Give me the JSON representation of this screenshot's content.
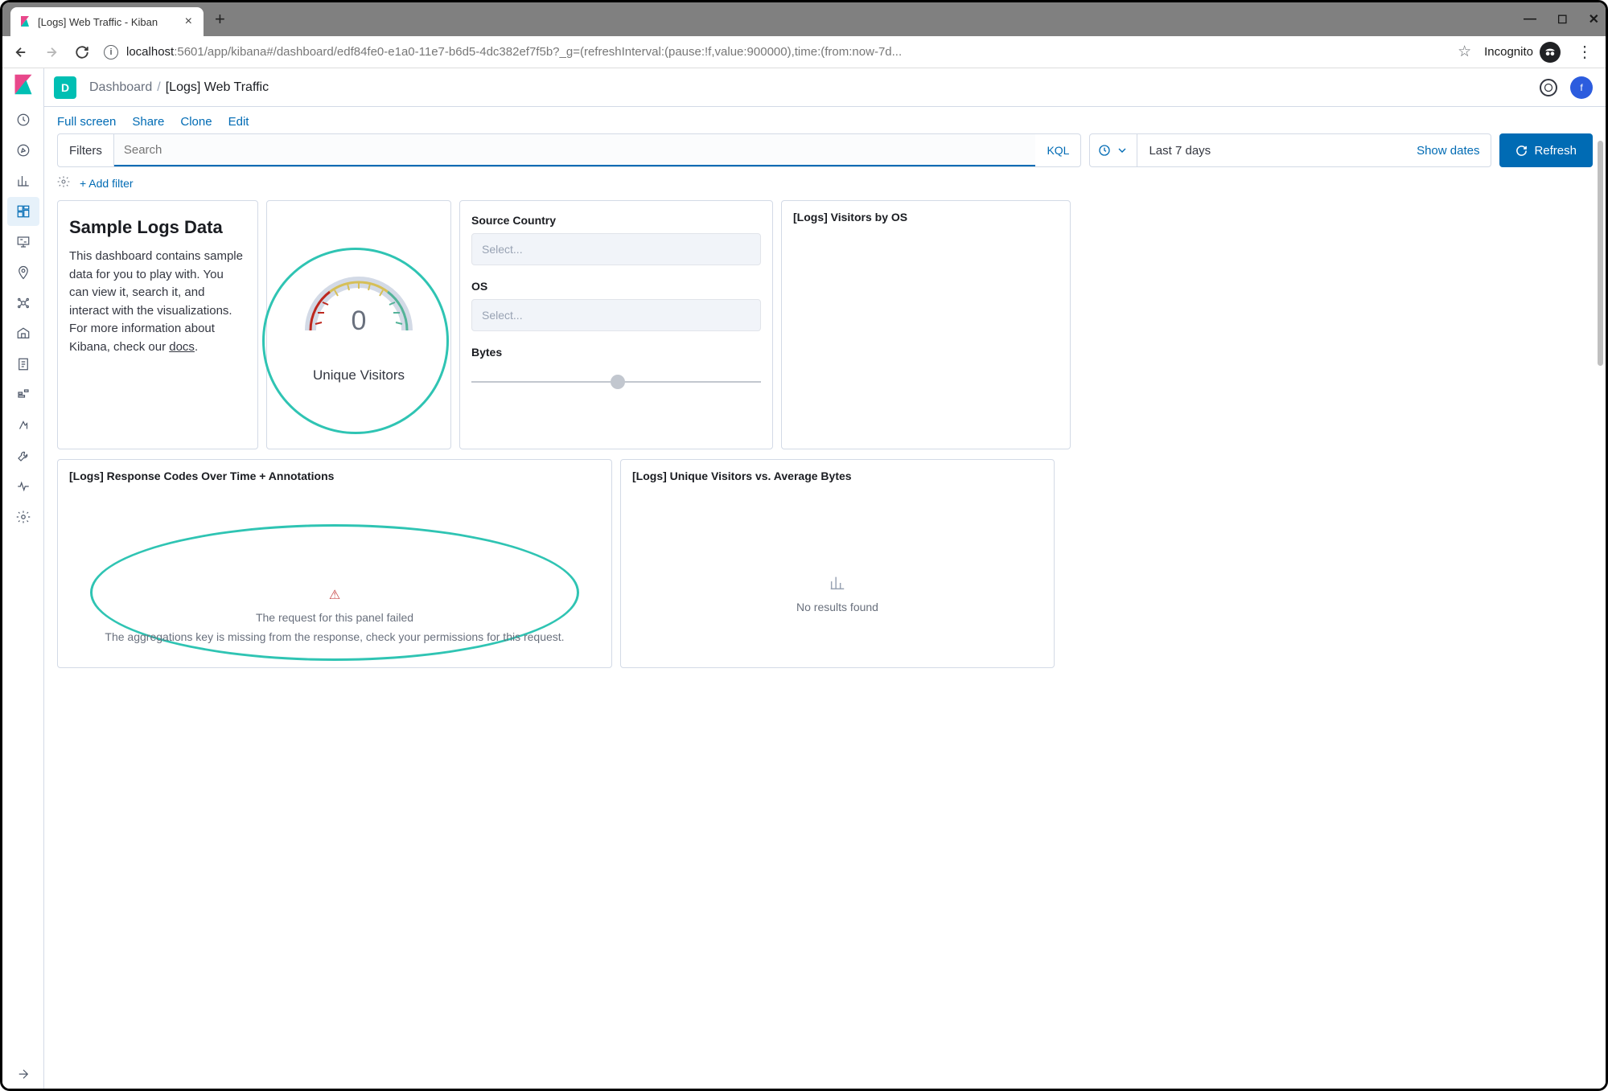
{
  "browser": {
    "tab_title": "[Logs] Web Traffic - Kiban",
    "url_host": "localhost",
    "url_port": ":5601",
    "url_path": "/app/kibana#/dashboard/edf84fe0-e1a0-11e7-b6d5-4dc382ef7f5b?_g=(refreshInterval:(pause:!f,value:900000),time:(from:now-7d...",
    "incognito_label": "Incognito"
  },
  "kibana": {
    "space_letter": "D",
    "breadcrumb_root": "Dashboard",
    "breadcrumb_current": "[Logs] Web Traffic",
    "avatar_letter": "f",
    "actions": {
      "fullscreen": "Full screen",
      "share": "Share",
      "clone": "Clone",
      "edit": "Edit"
    },
    "query": {
      "filters_label": "Filters",
      "search_placeholder": "Search",
      "kql_label": "KQL",
      "date_display": "Last 7 days",
      "show_dates": "Show dates",
      "refresh_label": "Refresh",
      "add_filter": "+ Add filter"
    },
    "panels": {
      "sample": {
        "heading": "Sample Logs Data",
        "body_prefix": "This dashboard contains sample data for you to play with. You can view it, search it, and interact with the visualizations. For more information about Kibana, check our ",
        "docs_link": "docs",
        "body_suffix": "."
      },
      "gauge": {
        "value": "0",
        "label": "Unique Visitors"
      },
      "controls": {
        "source_country_label": "Source Country",
        "os_label": "OS",
        "bytes_label": "Bytes",
        "select_placeholder": "Select..."
      },
      "visitors_os_title": "[Logs] Visitors by OS",
      "response_codes": {
        "title": "[Logs] Response Codes Over Time + Annotations",
        "error_title": "The request for this panel failed",
        "error_detail": "The aggregations key is missing from the response, check your permissions for this request."
      },
      "unique_vs_bytes": {
        "title": "[Logs] Unique Visitors vs. Average Bytes",
        "no_results": "No results found"
      }
    }
  }
}
